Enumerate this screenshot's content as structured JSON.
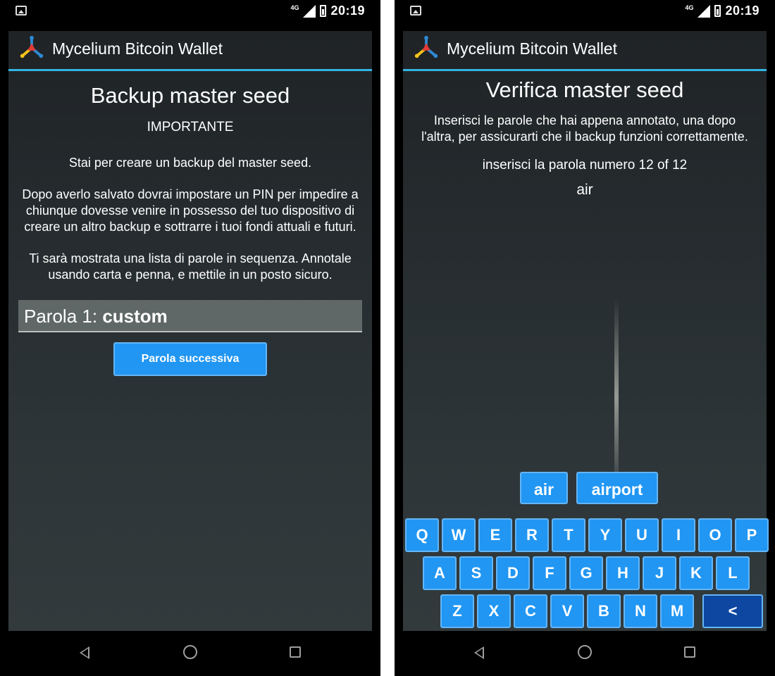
{
  "status_bar": {
    "network": "4G",
    "time": "20:19"
  },
  "app": {
    "title": "Mycelium Bitcoin Wallet"
  },
  "backup_screen": {
    "title": "Backup master seed",
    "subtitle": "IMPORTANTE",
    "paragraph1": "Stai per creare un backup del master seed.",
    "paragraph2": "Dopo averlo salvato dovrai impostare un PIN per impedire a chiunque dovesse venire in possesso del tuo dispositivo di creare un altro backup e sottrarre i tuoi fondi attuali e futuri.",
    "paragraph3": "Ti sarà mostrata una lista di parole in sequenza. Annotale usando carta e penna, e mettile in un posto sicuro.",
    "word_label": "Parola 1:",
    "word_value": "custom",
    "next_button": "Parola successiva"
  },
  "verify_screen": {
    "title": "Verifica master seed",
    "description": "Inserisci le parole che hai appena annotato, una dopo l'altra, per assicurarti che il backup funzioni correttamente.",
    "prompt": "inserisci la parola numero 12 of 12",
    "typed_value": "air",
    "suggestions": [
      "air",
      "airport"
    ],
    "keyboard_rows": [
      [
        "Q",
        "W",
        "E",
        "R",
        "T",
        "Y",
        "U",
        "I",
        "O",
        "P"
      ],
      [
        "A",
        "S",
        "D",
        "F",
        "G",
        "H",
        "J",
        "K",
        "L"
      ],
      [
        "Z",
        "X",
        "C",
        "V",
        "B",
        "N",
        "M"
      ]
    ],
    "backspace_label": "<"
  },
  "icons": {
    "status_image": "image-icon",
    "signal": "signal-icon",
    "battery": "battery-icon",
    "logo": "mycelium-logo",
    "nav_back": "back-icon",
    "nav_home": "home-icon",
    "nav_recents": "recents-icon"
  },
  "colors": {
    "accent": "#33b5e5",
    "button": "#2196f3",
    "backspace": "#0d47a1"
  }
}
